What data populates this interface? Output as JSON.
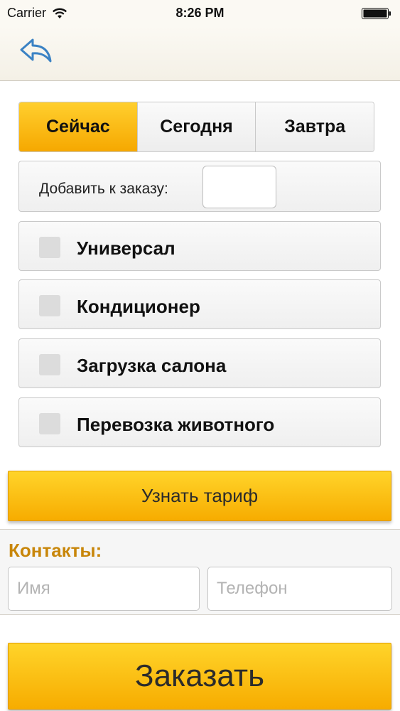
{
  "status_bar": {
    "carrier": "Carrier",
    "time": "8:26 PM",
    "icons": [
      "wifi-icon",
      "battery-icon"
    ]
  },
  "nav": {
    "back_icon": "back-arrow-icon"
  },
  "time_tabs": {
    "items": [
      {
        "label": "Сейчас",
        "active": true
      },
      {
        "label": "Сегодня",
        "active": false
      },
      {
        "label": "Завтра",
        "active": false
      }
    ]
  },
  "add_to_order": {
    "label": "Добавить к заказу:",
    "value": ""
  },
  "options": [
    {
      "label": "Универсал",
      "checked": false
    },
    {
      "label": "Кондиционер",
      "checked": false
    },
    {
      "label": "Загрузка салона",
      "checked": false
    },
    {
      "label": "Перевозка животного",
      "checked": false
    }
  ],
  "tariff_button": {
    "label": "Узнать тариф"
  },
  "contacts": {
    "title": "Контакты:",
    "name_placeholder": "Имя",
    "phone_placeholder": "Телефон",
    "name_value": "",
    "phone_value": ""
  },
  "order_button": {
    "label": "Заказать"
  },
  "colors": {
    "accent": "#f7ac00",
    "accent_light": "#ffd42a",
    "contacts_title": "#c8860a",
    "back_icon": "#3b82c4"
  }
}
